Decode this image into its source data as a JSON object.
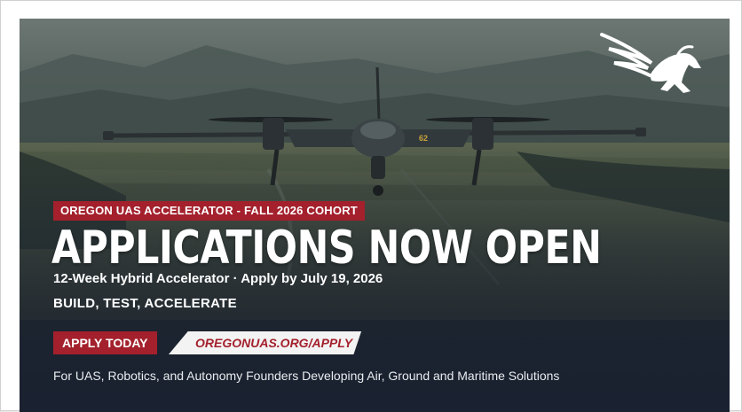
{
  "banner": {
    "logo_icon": "winged-horse-logo-icon",
    "cohort_tag": "OREGON UAS ACCELERATOR - FALL 2026 COHORT",
    "headline": "APPLICATIONS NOW OPEN",
    "subline": "12-Week Hybrid Accelerator · Apply by July 19, 2026",
    "tagline": "BUILD, TEST, ACCELERATE",
    "apply_label": "APPLY TODAY",
    "apply_url": "OREGONUAS.ORG/APPLY",
    "footer": "For UAS, Robotics, and Autonomy Founders Developing Air, Ground and Maritime Solutions",
    "drone_marking": "62"
  },
  "colors": {
    "accent_red": "#a3202c",
    "link_bg": "#f3f3f3",
    "text_white": "#ffffff"
  }
}
